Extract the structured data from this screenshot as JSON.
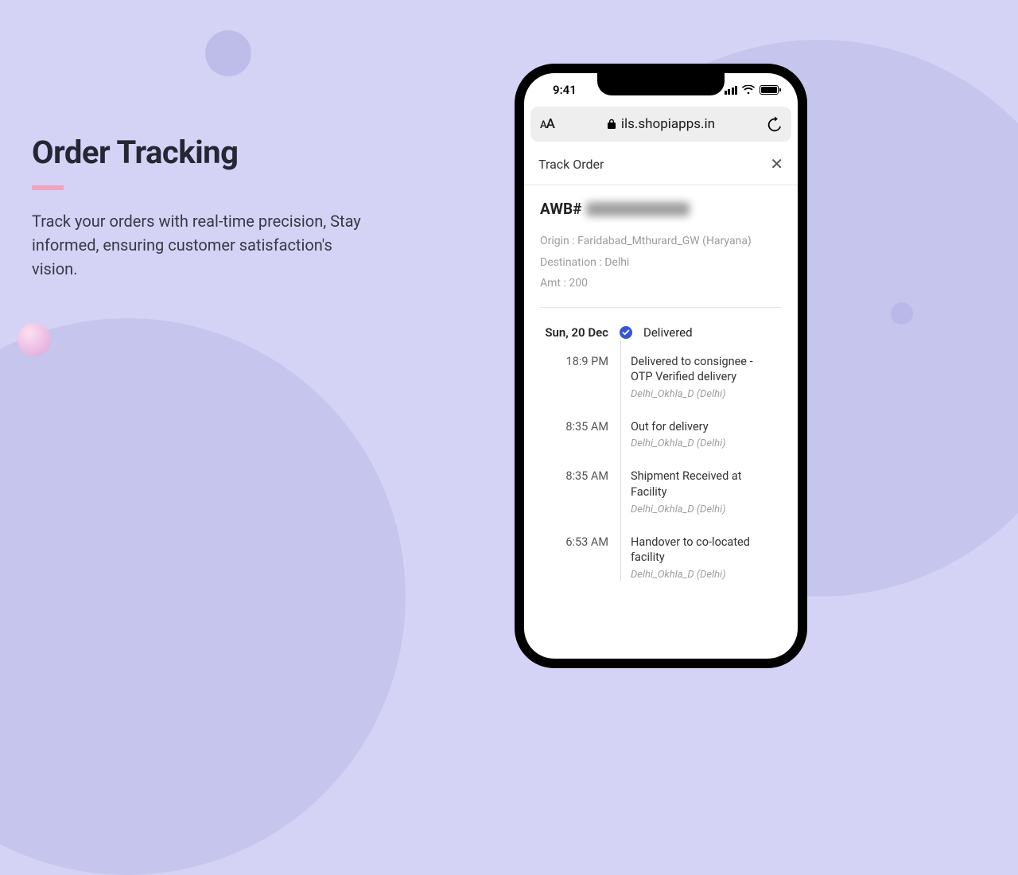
{
  "hero": {
    "title": "Order Tracking",
    "desc": "Track your orders with real-time precision, Stay informed, ensuring customer satisfaction's vision."
  },
  "statusbar": {
    "time": "9:41"
  },
  "urlbar": {
    "aA_small": "A",
    "aA_big": "A",
    "domain": "ils.shopiapps.in"
  },
  "track": {
    "title": "Track Order",
    "awb_label": "AWB#",
    "origin": "Origin : Faridabad_Mthurard_GW (Haryana)",
    "destination": "Destination : Delhi",
    "amt": "Amt : 200",
    "day": "Sun, 20 Dec",
    "day_status": "Delivered",
    "events": [
      {
        "time": "18:9 PM",
        "title": "Delivered to consignee - OTP Verified delivery",
        "loc": "Delhi_Okhla_D (Delhi)"
      },
      {
        "time": "8:35 AM",
        "title": "Out for delivery",
        "loc": "Delhi_Okhla_D (Delhi)"
      },
      {
        "time": "8:35 AM",
        "title": "Shipment Received at Facility",
        "loc": "Delhi_Okhla_D (Delhi)"
      },
      {
        "time": "6:53 AM",
        "title": "Handover to co-located facility",
        "loc": "Delhi_Okhla_D (Delhi)"
      }
    ]
  }
}
